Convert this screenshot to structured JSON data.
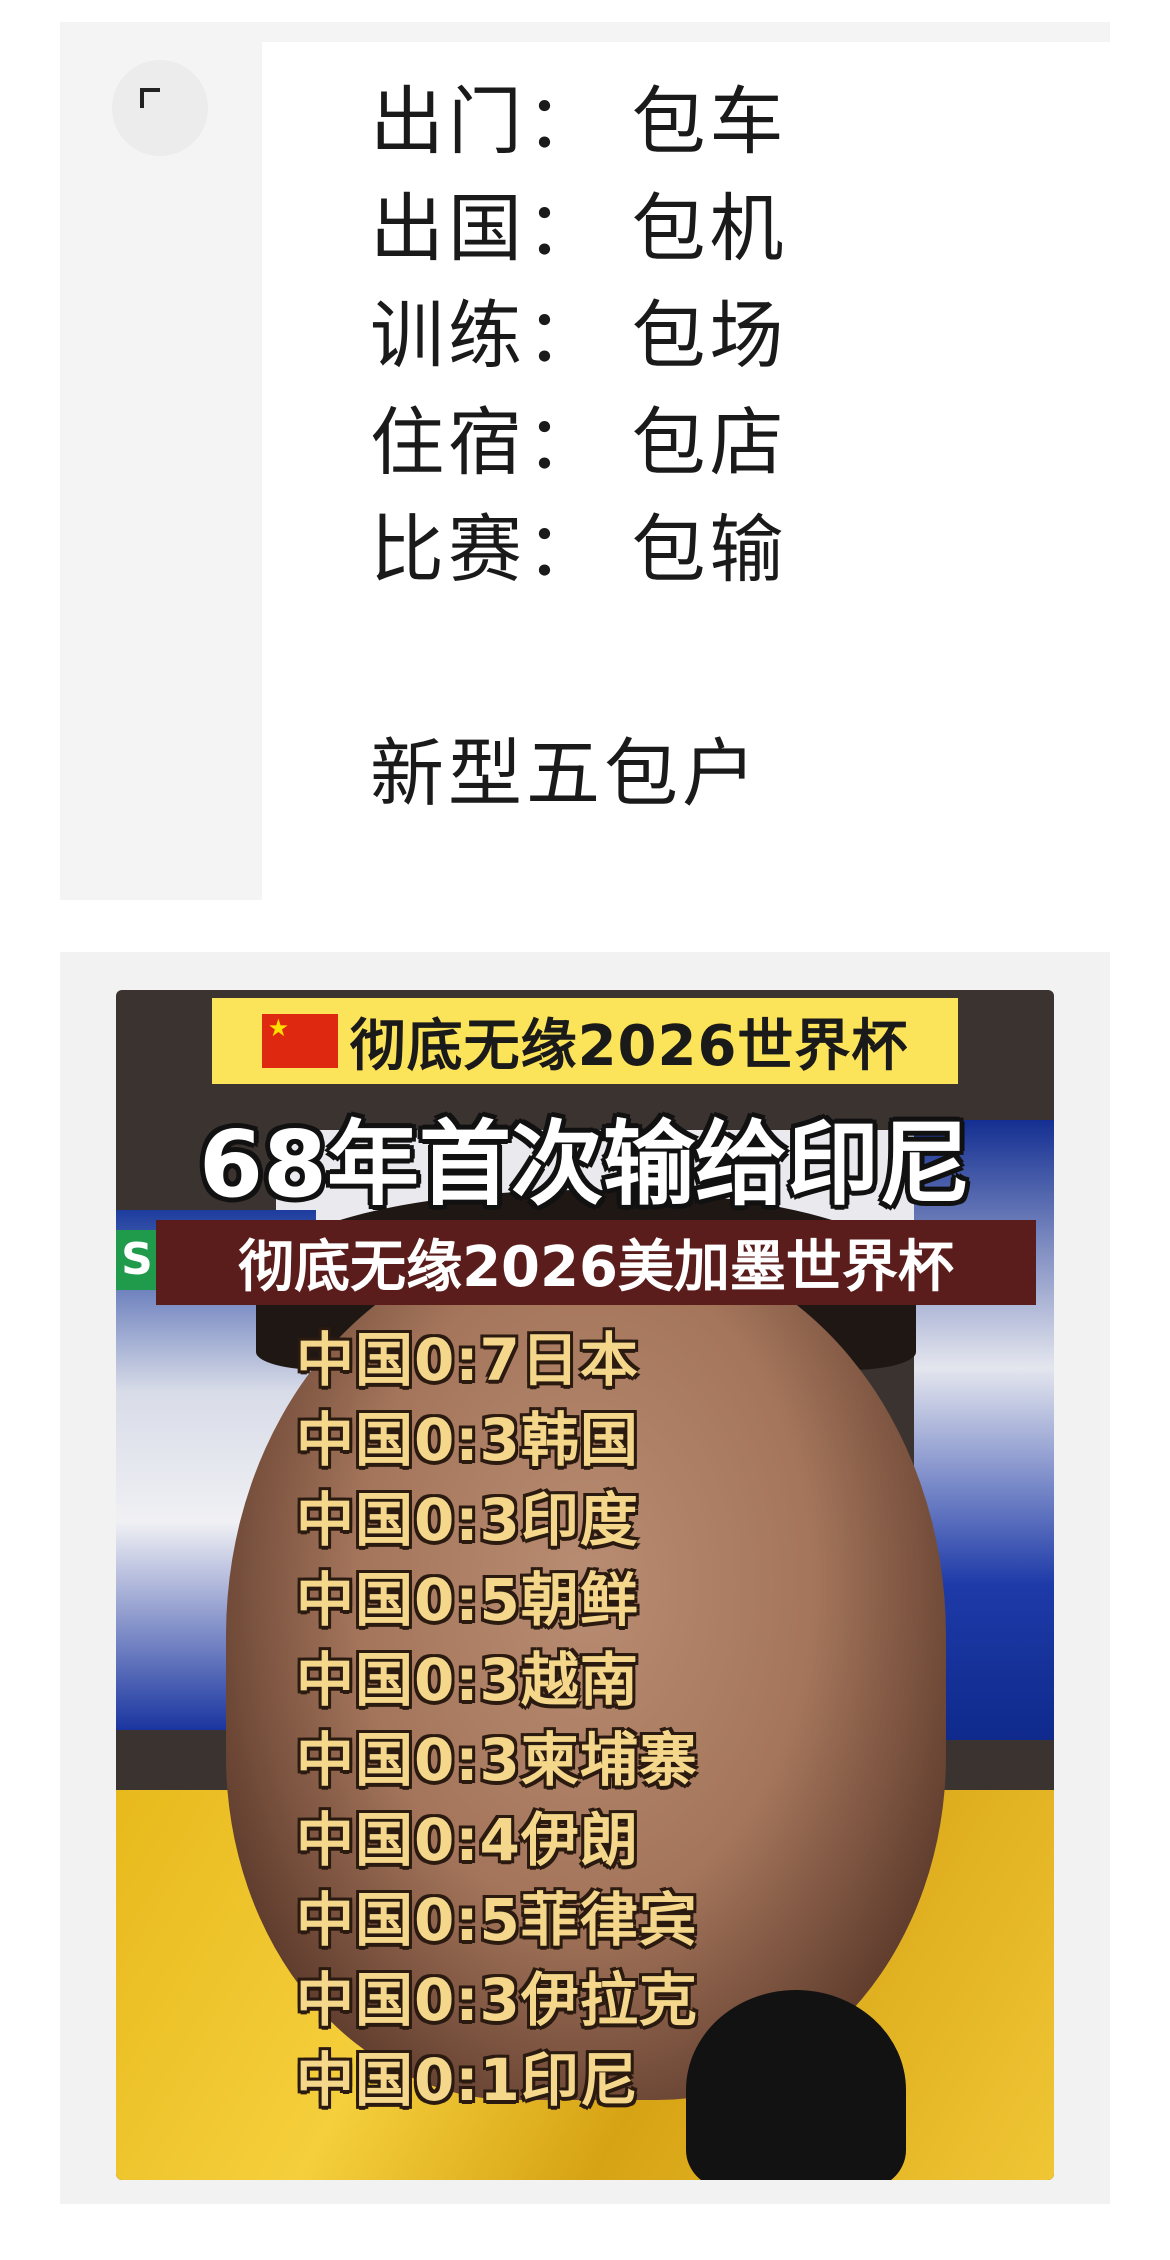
{
  "post": {
    "lines": [
      {
        "key": "出门",
        "sep": "：",
        "value": "包车"
      },
      {
        "key": "出国",
        "sep": "：",
        "value": "包机"
      },
      {
        "key": "训练",
        "sep": "：",
        "value": "包场"
      },
      {
        "key": "住宿",
        "sep": "：",
        "value": "包店"
      },
      {
        "key": "比赛",
        "sep": "：",
        "value": "包输"
      }
    ],
    "closing": "新型五包户",
    "expand_icon": "expand-icon"
  },
  "image": {
    "banner": "彻底无缘2026世界杯",
    "flag_icon": "china-flag-icon",
    "headline": "68年首次输给印尼",
    "subhead": "彻底无缘2026美加墨世界杯",
    "side_letter": "S",
    "scores": [
      "中国0:7日本",
      "中国0:3韩国",
      "中国0:3印度",
      "中国0:5朝鲜",
      "中国0:3越南",
      "中国0:3柬埔寨",
      "中国0:4伊朗",
      "中国0:5菲律宾",
      "中国0:3伊拉克",
      "中国0:1印尼"
    ]
  },
  "colors": {
    "banner_bg": "#fbe35a",
    "score_text": "#f4d78a",
    "jersey": "#f5cf3c"
  }
}
